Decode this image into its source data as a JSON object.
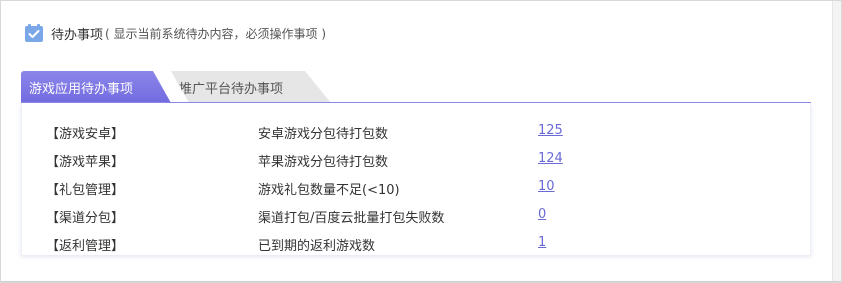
{
  "header": {
    "title": "待办事项",
    "subtitle": "( 显示当前系统待办内容，必须操作事项 )"
  },
  "tabs": [
    {
      "label": "游戏应用待办事项",
      "active": true
    },
    {
      "label": "推广平台待办事项",
      "active": false
    }
  ],
  "rows": [
    {
      "category": "【游戏安卓】",
      "description": "安卓游戏分包待打包数",
      "count": "125"
    },
    {
      "category": "【游戏苹果】",
      "description": "苹果游戏分包待打包数",
      "count": "124"
    },
    {
      "category": "【礼包管理】",
      "description": "游戏礼包数量不足(<10)",
      "count": "10"
    },
    {
      "category": "【渠道分包】",
      "description": "渠道打包/百度云批量打包失败数",
      "count": "0"
    },
    {
      "category": "【返利管理】",
      "description": "已到期的返利游戏数",
      "count": "1"
    }
  ],
  "colors": {
    "accent": "#7e78e6",
    "link": "#6b6bd6",
    "tab_inactive": "#e6e6e6",
    "icon": "#7aa7e8"
  }
}
